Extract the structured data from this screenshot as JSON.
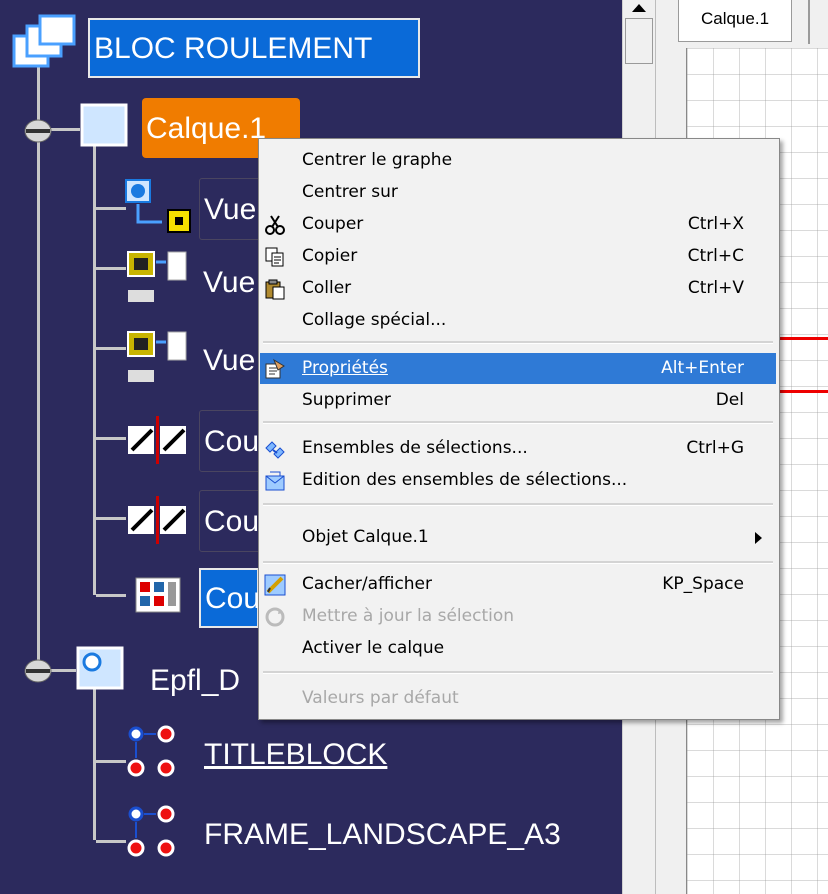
{
  "tree": {
    "root": "BLOC ROULEMENT",
    "layer": "Calque.1",
    "views": [
      "Vue",
      "Vue",
      "Vue"
    ],
    "sections": [
      "Cou",
      "Cou",
      "Cou"
    ],
    "epfl": "Epfl_D",
    "titleblock": "TITLEBLOCK",
    "frame": "FRAME_LANDSCAPE_A3"
  },
  "drawing": {
    "tab_label": "Calque.1"
  },
  "menu": {
    "items": [
      {
        "label": "Centrer le graphe",
        "shortcut": "",
        "icon": ""
      },
      {
        "label": "Centrer sur",
        "shortcut": "",
        "icon": ""
      },
      {
        "label": "Couper",
        "shortcut": "Ctrl+X",
        "icon": "scissors-icon"
      },
      {
        "label": "Copier",
        "shortcut": "Ctrl+C",
        "icon": "copy-icon"
      },
      {
        "label": "Coller",
        "shortcut": "Ctrl+V",
        "icon": "paste-icon"
      },
      {
        "label": "Collage spécial...",
        "shortcut": "",
        "icon": ""
      },
      {
        "label": "Propriétés",
        "shortcut": "Alt+Enter",
        "icon": "properties-icon",
        "highlighted": true
      },
      {
        "label": "Supprimer",
        "shortcut": "Del",
        "icon": ""
      },
      {
        "label": "Ensembles de sélections...",
        "shortcut": "Ctrl+G",
        "icon": "selection-sets-icon"
      },
      {
        "label": "Edition des ensembles de sélections...",
        "shortcut": "",
        "icon": "edit-selection-sets-icon"
      },
      {
        "label": "Objet Calque.1",
        "shortcut": "",
        "icon": "",
        "submenu": true
      },
      {
        "label": "Cacher/afficher",
        "shortcut": "KP_Space",
        "icon": "hide-show-icon"
      },
      {
        "label": "Mettre à jour la sélection",
        "shortcut": "",
        "icon": "update-icon",
        "disabled": true
      },
      {
        "label": "Activer le calque",
        "shortcut": "",
        "icon": ""
      },
      {
        "label": "Valeurs par défaut",
        "shortcut": "",
        "icon": "",
        "disabled": true
      }
    ]
  },
  "colors": {
    "tree_bg": "#2c2a5d",
    "selection_orange": "#f07c00",
    "selection_blue": "#0a6ad8",
    "menu_highlight": "#2f7ad6",
    "annotation_red": "#e00000"
  }
}
